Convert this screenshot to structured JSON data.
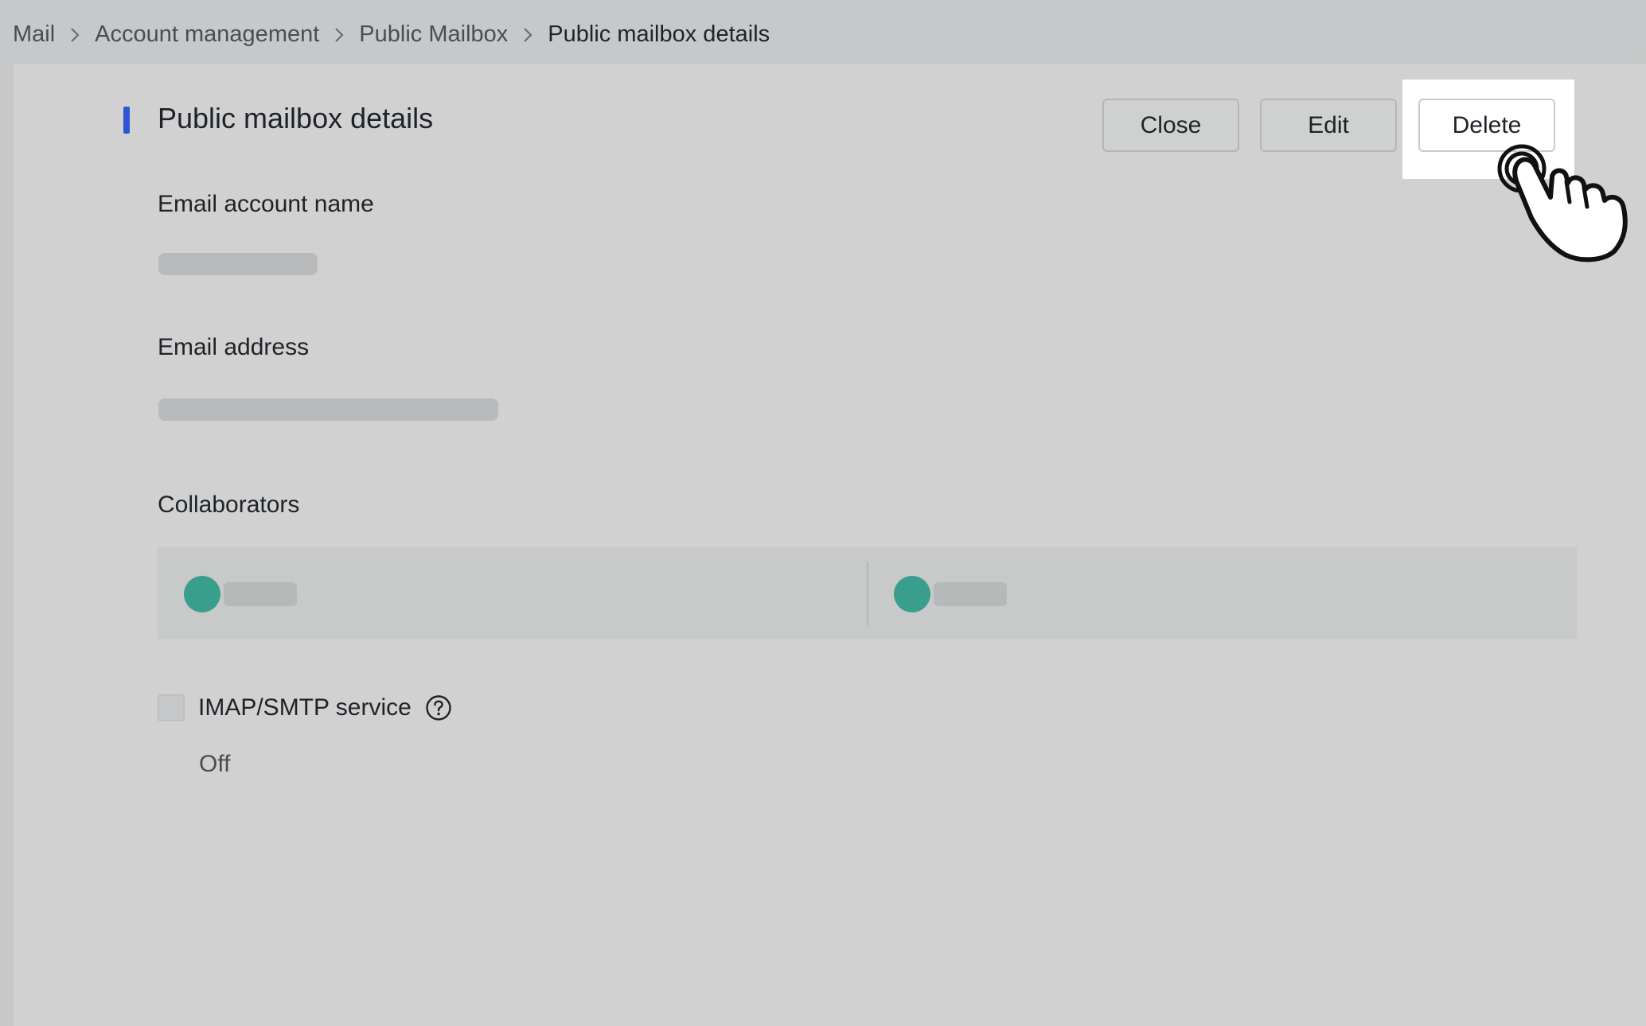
{
  "breadcrumb": {
    "items": [
      "Mail",
      "Account management",
      "Public Mailbox"
    ],
    "current": "Public mailbox details"
  },
  "header": {
    "title": "Public mailbox details",
    "accent_color": "#2f54d4"
  },
  "actions": {
    "close_label": "Close",
    "edit_label": "Edit",
    "delete_label": "Delete",
    "highlighted": "Delete"
  },
  "fields": {
    "email_account_name_label": "Email account name",
    "email_address_label": "Email address",
    "collaborators_label": "Collaborators"
  },
  "collaborators": {
    "avatar_color": "#3a9e8c"
  },
  "imap": {
    "label": "IMAP/SMTP service",
    "status": "Off",
    "checked": false,
    "help_icon": "question-circle-icon"
  },
  "cursor": {
    "icon": "hand-pointer-icon",
    "state": "clicking"
  }
}
